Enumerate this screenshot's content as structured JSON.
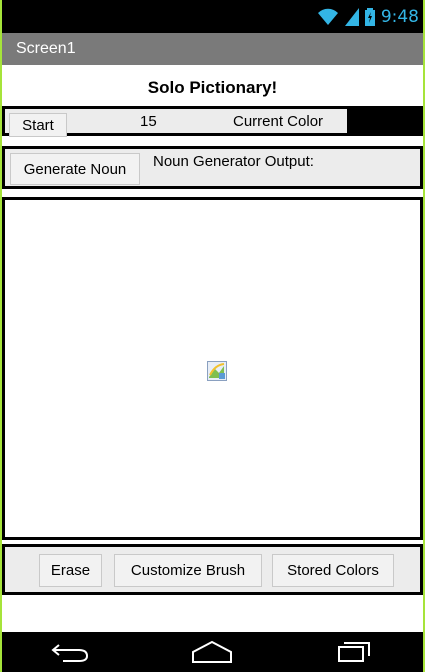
{
  "status": {
    "time": "9:48"
  },
  "screen": {
    "title": "Screen1"
  },
  "app": {
    "title": "Solo Pictionary!"
  },
  "controls": {
    "start_label": "Start",
    "timer_value": "15",
    "current_color_label": "Current Color",
    "current_color": "#000000",
    "generate_label": "Generate Noun",
    "noun_output_label": "Noun Generator Output:"
  },
  "bottom": {
    "erase_label": "Erase",
    "customize_label": "Customize Brush",
    "stored_colors_label": "Stored Colors"
  },
  "icons": {
    "canvas_image": "broken-image-icon"
  },
  "colors": {
    "status_accent": "#33b5e5",
    "titlebar": "#7a7a7a",
    "frame": "#a6e43a"
  }
}
